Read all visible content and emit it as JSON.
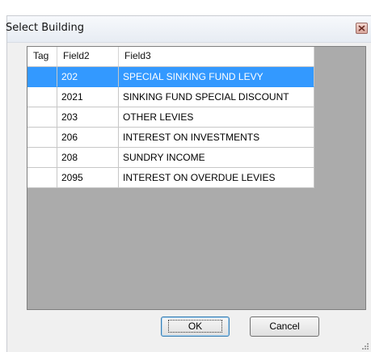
{
  "dialog": {
    "title": "Select Building",
    "close_icon": "close-icon"
  },
  "grid": {
    "columns": [
      "Tag",
      "Field2",
      "Field3"
    ],
    "selected_row": 0,
    "rows": [
      {
        "tag": "",
        "field2": "202",
        "field3": "SPECIAL SINKING FUND LEVY"
      },
      {
        "tag": "",
        "field2": "2021",
        "field3": "SINKING FUND SPECIAL DISCOUNT"
      },
      {
        "tag": "",
        "field2": "203",
        "field3": "OTHER LEVIES"
      },
      {
        "tag": "",
        "field2": "206",
        "field3": "INTEREST ON INVESTMENTS"
      },
      {
        "tag": "",
        "field2": "208",
        "field3": "SUNDRY INCOME"
      },
      {
        "tag": "",
        "field2": "2095",
        "field3": "INTEREST ON OVERDUE LEVIES"
      }
    ]
  },
  "buttons": {
    "ok_label": "OK",
    "cancel_label": "Cancel"
  },
  "colors": {
    "selection": "#3399ff",
    "grid_background": "#ababab",
    "dialog_background": "#f0f0f0"
  }
}
